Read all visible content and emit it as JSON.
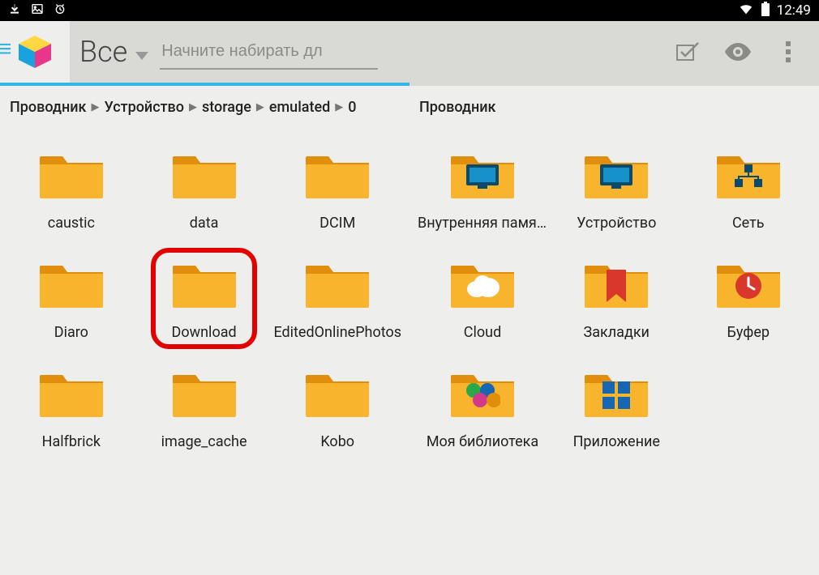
{
  "status": {
    "time": "12:49"
  },
  "toolbar": {
    "spinner_label": "Все",
    "search_placeholder": "Начните набирать дл"
  },
  "left": {
    "crumbs": [
      "Проводник",
      "Устройство",
      "storage",
      "emulated",
      "0"
    ],
    "items": [
      {
        "label": "caustic"
      },
      {
        "label": "data"
      },
      {
        "label": "DCIM"
      },
      {
        "label": "Diaro"
      },
      {
        "label": "Download",
        "highlight": true
      },
      {
        "label": "EditedOnlinePhotos"
      },
      {
        "label": "Halfbrick"
      },
      {
        "label": "image_cache"
      },
      {
        "label": "Kobo"
      }
    ]
  },
  "right": {
    "title": "Проводник",
    "items": [
      {
        "label": "Внутренняя память",
        "badge": "monitor"
      },
      {
        "label": "Устройство",
        "badge": "monitor"
      },
      {
        "label": "Сеть",
        "badge": "network"
      },
      {
        "label": "Cloud",
        "badge": "cloud"
      },
      {
        "label": "Закладки",
        "badge": "bookmark"
      },
      {
        "label": "Буфер",
        "badge": "clock"
      },
      {
        "label": "Моя библиотека",
        "badge": "circles"
      },
      {
        "label": "Приложение",
        "badge": "grid"
      }
    ]
  }
}
